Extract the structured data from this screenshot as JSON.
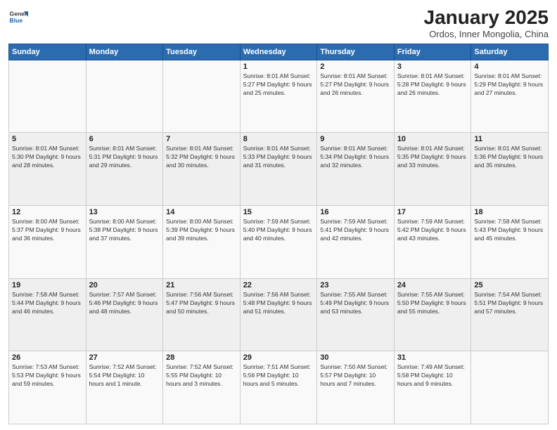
{
  "logo": {
    "line1": "General",
    "line2": "Blue"
  },
  "title": "January 2025",
  "subtitle": "Ordos, Inner Mongolia, China",
  "header_color": "#2b6cb0",
  "days_of_week": [
    "Sunday",
    "Monday",
    "Tuesday",
    "Wednesday",
    "Thursday",
    "Friday",
    "Saturday"
  ],
  "weeks": [
    [
      {
        "num": "",
        "info": ""
      },
      {
        "num": "",
        "info": ""
      },
      {
        "num": "",
        "info": ""
      },
      {
        "num": "1",
        "info": "Sunrise: 8:01 AM\nSunset: 5:27 PM\nDaylight: 9 hours and 25 minutes."
      },
      {
        "num": "2",
        "info": "Sunrise: 8:01 AM\nSunset: 5:27 PM\nDaylight: 9 hours and 26 minutes."
      },
      {
        "num": "3",
        "info": "Sunrise: 8:01 AM\nSunset: 5:28 PM\nDaylight: 9 hours and 26 minutes."
      },
      {
        "num": "4",
        "info": "Sunrise: 8:01 AM\nSunset: 5:29 PM\nDaylight: 9 hours and 27 minutes."
      }
    ],
    [
      {
        "num": "5",
        "info": "Sunrise: 8:01 AM\nSunset: 5:30 PM\nDaylight: 9 hours and 28 minutes."
      },
      {
        "num": "6",
        "info": "Sunrise: 8:01 AM\nSunset: 5:31 PM\nDaylight: 9 hours and 29 minutes."
      },
      {
        "num": "7",
        "info": "Sunrise: 8:01 AM\nSunset: 5:32 PM\nDaylight: 9 hours and 30 minutes."
      },
      {
        "num": "8",
        "info": "Sunrise: 8:01 AM\nSunset: 5:33 PM\nDaylight: 9 hours and 31 minutes."
      },
      {
        "num": "9",
        "info": "Sunrise: 8:01 AM\nSunset: 5:34 PM\nDaylight: 9 hours and 32 minutes."
      },
      {
        "num": "10",
        "info": "Sunrise: 8:01 AM\nSunset: 5:35 PM\nDaylight: 9 hours and 33 minutes."
      },
      {
        "num": "11",
        "info": "Sunrise: 8:01 AM\nSunset: 5:36 PM\nDaylight: 9 hours and 35 minutes."
      }
    ],
    [
      {
        "num": "12",
        "info": "Sunrise: 8:00 AM\nSunset: 5:37 PM\nDaylight: 9 hours and 36 minutes."
      },
      {
        "num": "13",
        "info": "Sunrise: 8:00 AM\nSunset: 5:38 PM\nDaylight: 9 hours and 37 minutes."
      },
      {
        "num": "14",
        "info": "Sunrise: 8:00 AM\nSunset: 5:39 PM\nDaylight: 9 hours and 39 minutes."
      },
      {
        "num": "15",
        "info": "Sunrise: 7:59 AM\nSunset: 5:40 PM\nDaylight: 9 hours and 40 minutes."
      },
      {
        "num": "16",
        "info": "Sunrise: 7:59 AM\nSunset: 5:41 PM\nDaylight: 9 hours and 42 minutes."
      },
      {
        "num": "17",
        "info": "Sunrise: 7:59 AM\nSunset: 5:42 PM\nDaylight: 9 hours and 43 minutes."
      },
      {
        "num": "18",
        "info": "Sunrise: 7:58 AM\nSunset: 5:43 PM\nDaylight: 9 hours and 45 minutes."
      }
    ],
    [
      {
        "num": "19",
        "info": "Sunrise: 7:58 AM\nSunset: 5:44 PM\nDaylight: 9 hours and 46 minutes."
      },
      {
        "num": "20",
        "info": "Sunrise: 7:57 AM\nSunset: 5:46 PM\nDaylight: 9 hours and 48 minutes."
      },
      {
        "num": "21",
        "info": "Sunrise: 7:56 AM\nSunset: 5:47 PM\nDaylight: 9 hours and 50 minutes."
      },
      {
        "num": "22",
        "info": "Sunrise: 7:56 AM\nSunset: 5:48 PM\nDaylight: 9 hours and 51 minutes."
      },
      {
        "num": "23",
        "info": "Sunrise: 7:55 AM\nSunset: 5:49 PM\nDaylight: 9 hours and 53 minutes."
      },
      {
        "num": "24",
        "info": "Sunrise: 7:55 AM\nSunset: 5:50 PM\nDaylight: 9 hours and 55 minutes."
      },
      {
        "num": "25",
        "info": "Sunrise: 7:54 AM\nSunset: 5:51 PM\nDaylight: 9 hours and 57 minutes."
      }
    ],
    [
      {
        "num": "26",
        "info": "Sunrise: 7:53 AM\nSunset: 5:53 PM\nDaylight: 9 hours and 59 minutes."
      },
      {
        "num": "27",
        "info": "Sunrise: 7:52 AM\nSunset: 5:54 PM\nDaylight: 10 hours and 1 minute."
      },
      {
        "num": "28",
        "info": "Sunrise: 7:52 AM\nSunset: 5:55 PM\nDaylight: 10 hours and 3 minutes."
      },
      {
        "num": "29",
        "info": "Sunrise: 7:51 AM\nSunset: 5:56 PM\nDaylight: 10 hours and 5 minutes."
      },
      {
        "num": "30",
        "info": "Sunrise: 7:50 AM\nSunset: 5:57 PM\nDaylight: 10 hours and 7 minutes."
      },
      {
        "num": "31",
        "info": "Sunrise: 7:49 AM\nSunset: 5:58 PM\nDaylight: 10 hours and 9 minutes."
      },
      {
        "num": "",
        "info": ""
      }
    ]
  ]
}
